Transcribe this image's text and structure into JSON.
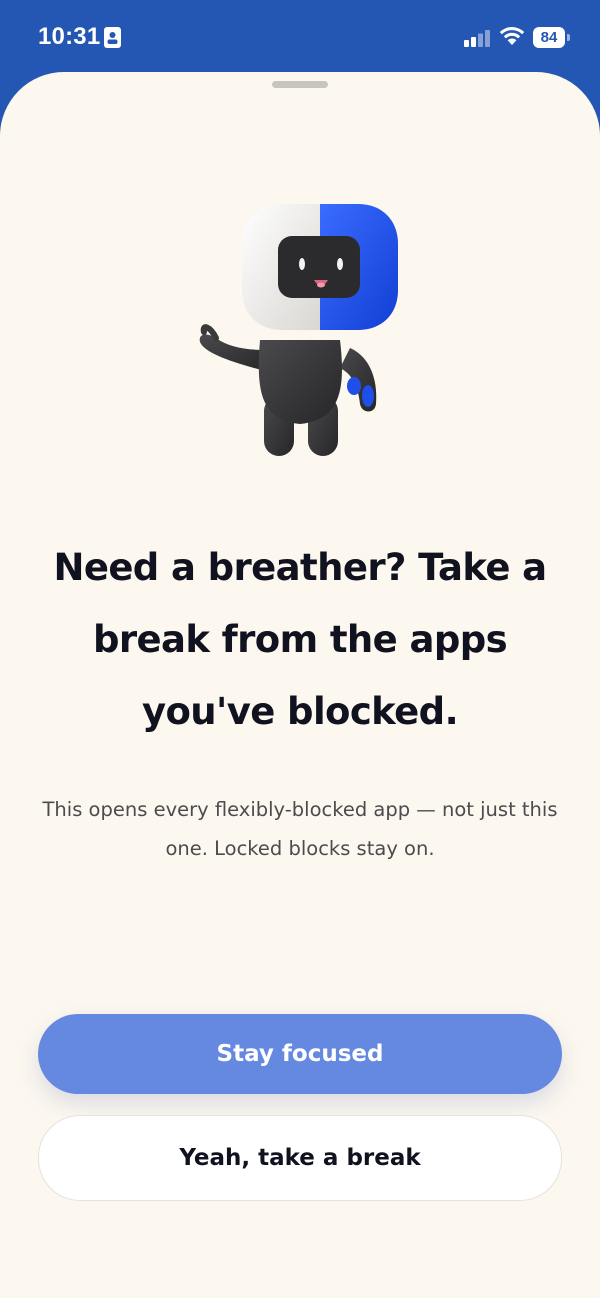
{
  "status_bar": {
    "time": "10:31",
    "battery_level": "84",
    "icons": [
      "id-badge-icon",
      "cellular-signal-icon",
      "wifi-icon",
      "battery-icon"
    ]
  },
  "sheet": {
    "mascot": "mascot-character-icon",
    "headline": "Need a breather? Take a break from the apps you've blocked.",
    "subtext": "This opens every flexibly-blocked app — not just this one. Locked blocks stay on.",
    "primary_button_label": "Stay focused",
    "secondary_button_label": "Yeah, take a break"
  },
  "colors": {
    "status_bar_bg": "#2457b3",
    "sheet_bg": "#fdf8ef",
    "primary_button": "#6588e0",
    "mascot_blue": "#1f4fe8"
  }
}
